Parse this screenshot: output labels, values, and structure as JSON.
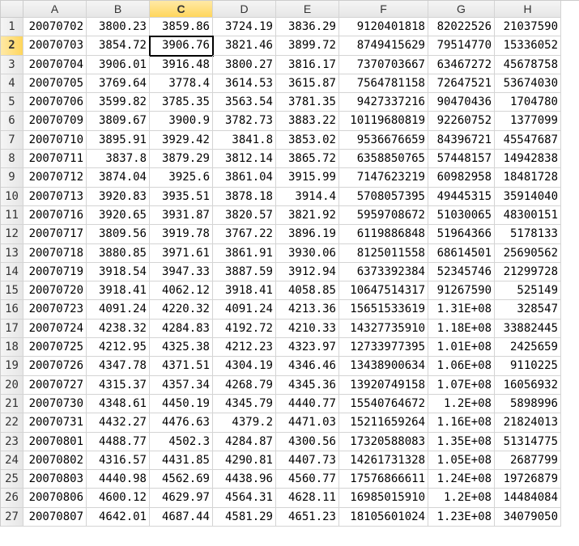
{
  "columns": [
    "A",
    "B",
    "C",
    "D",
    "E",
    "F",
    "G",
    "H"
  ],
  "active": {
    "row": 2,
    "col": 3
  },
  "rows": [
    {
      "n": 1,
      "c": [
        "20070702",
        "3800.23",
        "3859.86",
        "3724.19",
        "3836.29",
        "9120401818",
        "82022526",
        "21037590"
      ]
    },
    {
      "n": 2,
      "c": [
        "20070703",
        "3854.72",
        "3906.76",
        "3821.46",
        "3899.72",
        "8749415629",
        "79514770",
        "15336052"
      ]
    },
    {
      "n": 3,
      "c": [
        "20070704",
        "3906.01",
        "3916.48",
        "3800.27",
        "3816.17",
        "7370703667",
        "63467272",
        "45678758"
      ]
    },
    {
      "n": 4,
      "c": [
        "20070705",
        "3769.64",
        "3778.4",
        "3614.53",
        "3615.87",
        "7564781158",
        "72647521",
        "53674030"
      ]
    },
    {
      "n": 5,
      "c": [
        "20070706",
        "3599.82",
        "3785.35",
        "3563.54",
        "3781.35",
        "9427337216",
        "90470436",
        "1704780"
      ]
    },
    {
      "n": 6,
      "c": [
        "20070709",
        "3809.67",
        "3900.9",
        "3782.73",
        "3883.22",
        "10119680819",
        "92260752",
        "1377099"
      ]
    },
    {
      "n": 7,
      "c": [
        "20070710",
        "3895.91",
        "3929.42",
        "3841.8",
        "3853.02",
        "9536676659",
        "84396721",
        "45547687"
      ]
    },
    {
      "n": 8,
      "c": [
        "20070711",
        "3837.8",
        "3879.29",
        "3812.14",
        "3865.72",
        "6358850765",
        "57448157",
        "14942838"
      ]
    },
    {
      "n": 9,
      "c": [
        "20070712",
        "3874.04",
        "3925.6",
        "3861.04",
        "3915.99",
        "7147623219",
        "60982958",
        "18481728"
      ]
    },
    {
      "n": 10,
      "c": [
        "20070713",
        "3920.83",
        "3935.51",
        "3878.18",
        "3914.4",
        "5708057395",
        "49445315",
        "35914040"
      ]
    },
    {
      "n": 11,
      "c": [
        "20070716",
        "3920.65",
        "3931.87",
        "3820.57",
        "3821.92",
        "5959708672",
        "51030065",
        "48300151"
      ]
    },
    {
      "n": 12,
      "c": [
        "20070717",
        "3809.56",
        "3919.78",
        "3767.22",
        "3896.19",
        "6119886848",
        "51964366",
        "5178133"
      ]
    },
    {
      "n": 13,
      "c": [
        "20070718",
        "3880.85",
        "3971.61",
        "3861.91",
        "3930.06",
        "8125011558",
        "68614501",
        "25690562"
      ]
    },
    {
      "n": 14,
      "c": [
        "20070719",
        "3918.54",
        "3947.33",
        "3887.59",
        "3912.94",
        "6373392384",
        "52345746",
        "21299728"
      ]
    },
    {
      "n": 15,
      "c": [
        "20070720",
        "3918.41",
        "4062.12",
        "3918.41",
        "4058.85",
        "10647514317",
        "91267590",
        "525149"
      ]
    },
    {
      "n": 16,
      "c": [
        "20070723",
        "4091.24",
        "4220.32",
        "4091.24",
        "4213.36",
        "15651533619",
        "1.31E+08",
        "328547"
      ]
    },
    {
      "n": 17,
      "c": [
        "20070724",
        "4238.32",
        "4284.83",
        "4192.72",
        "4210.33",
        "14327735910",
        "1.18E+08",
        "33882445"
      ]
    },
    {
      "n": 18,
      "c": [
        "20070725",
        "4212.95",
        "4325.38",
        "4212.23",
        "4323.97",
        "12733977395",
        "1.01E+08",
        "2425659"
      ]
    },
    {
      "n": 19,
      "c": [
        "20070726",
        "4347.78",
        "4371.51",
        "4304.19",
        "4346.46",
        "13438900634",
        "1.06E+08",
        "9110225"
      ]
    },
    {
      "n": 20,
      "c": [
        "20070727",
        "4315.37",
        "4357.34",
        "4268.79",
        "4345.36",
        "13920749158",
        "1.07E+08",
        "16056932"
      ]
    },
    {
      "n": 21,
      "c": [
        "20070730",
        "4348.61",
        "4450.19",
        "4345.79",
        "4440.77",
        "15540764672",
        "1.2E+08",
        "5898996"
      ]
    },
    {
      "n": 22,
      "c": [
        "20070731",
        "4432.27",
        "4476.63",
        "4379.2",
        "4471.03",
        "15211659264",
        "1.16E+08",
        "21824013"
      ]
    },
    {
      "n": 23,
      "c": [
        "20070801",
        "4488.77",
        "4502.3",
        "4284.87",
        "4300.56",
        "17320588083",
        "1.35E+08",
        "51314775"
      ]
    },
    {
      "n": 24,
      "c": [
        "20070802",
        "4316.57",
        "4431.85",
        "4290.81",
        "4407.73",
        "14261731328",
        "1.05E+08",
        "2687799"
      ]
    },
    {
      "n": 25,
      "c": [
        "20070803",
        "4440.98",
        "4562.69",
        "4438.96",
        "4560.77",
        "17576866611",
        "1.24E+08",
        "19726879"
      ]
    },
    {
      "n": 26,
      "c": [
        "20070806",
        "4600.12",
        "4629.97",
        "4564.31",
        "4628.11",
        "16985015910",
        "1.2E+08",
        "14484084"
      ]
    },
    {
      "n": 27,
      "c": [
        "20070807",
        "4642.01",
        "4687.44",
        "4581.29",
        "4651.23",
        "18105601024",
        "1.23E+08",
        "34079050"
      ]
    }
  ]
}
